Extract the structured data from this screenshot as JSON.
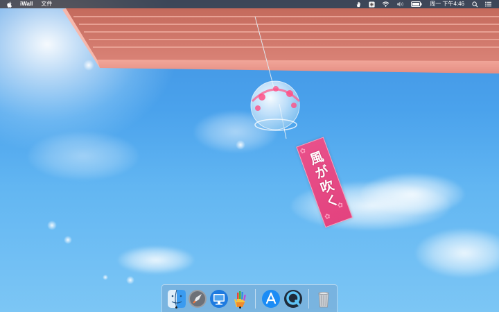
{
  "menubar": {
    "apple_icon": "apple-icon",
    "app_name": "iWall",
    "menus": [
      "文件"
    ],
    "status_icons": [
      "hand-icon",
      "input-method-icon",
      "wifi-icon",
      "volume-icon",
      "battery-icon"
    ],
    "clock": "周一 下午4:46",
    "right_icons": [
      "spotlight-search-icon",
      "notification-center-icon"
    ]
  },
  "wallpaper": {
    "tanzaku_text": "風が吹く"
  },
  "dock": {
    "apps": [
      {
        "name": "Finder",
        "icon": "finder-icon",
        "running": true
      },
      {
        "name": "Launchpad",
        "icon": "launchpad-icon",
        "running": false
      },
      {
        "name": "Screen Sharing",
        "icon": "monitor-icon",
        "running": false
      },
      {
        "name": "iWall",
        "icon": "iwall-hand-icon",
        "running": true
      },
      {
        "name": "App Store",
        "icon": "app-store-icon",
        "running": false
      },
      {
        "name": "QuickTime Player",
        "icon": "quicktime-icon",
        "running": false
      },
      {
        "name": "Trash",
        "icon": "trash-icon",
        "running": false
      }
    ],
    "colors": {
      "finder": "#3a9bf0",
      "launchpad": "#8e8e93",
      "screen_sharing": "#1e7be0",
      "app_store": "#1b8cf5",
      "quicktime": "#1f2b3a"
    }
  }
}
